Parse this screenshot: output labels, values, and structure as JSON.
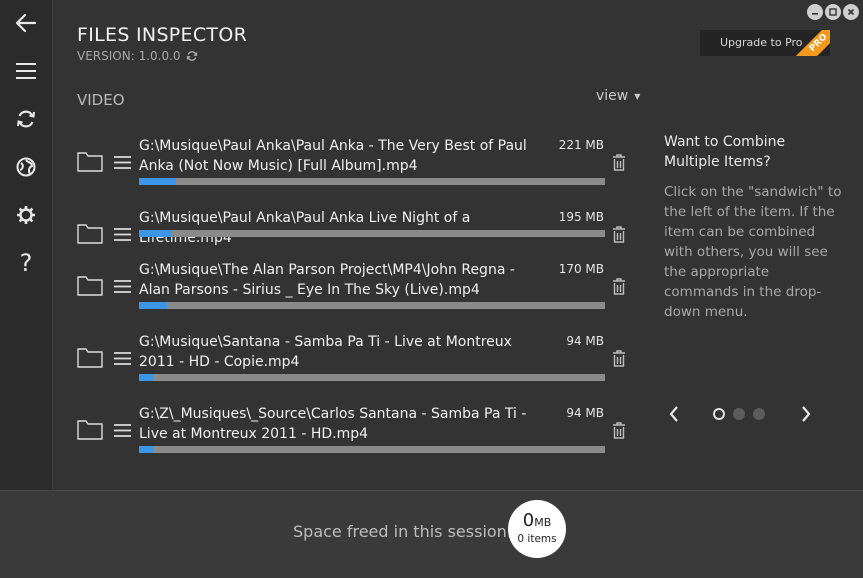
{
  "window": {
    "title": "FILES INSPECTOR",
    "version": "VERSION: 1.0.0.0"
  },
  "sidebar": {
    "items": [
      {
        "name": "back",
        "icon": "arrow-left-icon"
      },
      {
        "name": "menu",
        "icon": "hamburger-icon"
      },
      {
        "name": "refresh",
        "icon": "refresh-icon"
      },
      {
        "name": "globe",
        "icon": "globe-icon"
      },
      {
        "name": "settings",
        "icon": "gear-icon"
      },
      {
        "name": "help",
        "icon": "question-icon",
        "glyph": "?"
      }
    ]
  },
  "upgrade": {
    "label": "Upgrade to Pro",
    "badge": "PRO",
    "badge_color": "#f39a1d"
  },
  "main": {
    "section_title": "VIDEO",
    "view_label": "view",
    "view_caret": "▼"
  },
  "files": [
    {
      "name": "G:\\Musique\\Paul Anka\\Paul Anka - The Very Best of Paul Anka (Not Now Music) [Full Album].mp4",
      "size": "221 MB",
      "progress": 0.08
    },
    {
      "name": "G:\\Musique\\Paul Anka\\Paul Anka Live Night of a Lifetime.mp4",
      "size": "195 MB",
      "progress": 0.07
    },
    {
      "name": "G:\\Musique\\The Alan Parson Project\\MP4\\John Regna - Alan Parsons - Sirius _ Eye In The Sky (Live).mp4",
      "size": "170 MB",
      "progress": 0.06
    },
    {
      "name": "G:\\Musique\\Santana - Samba Pa Ti - Live at Montreux 2011 - HD - Copie.mp4",
      "size": "94 MB",
      "progress": 0.03
    },
    {
      "name": "G:\\Z\\_Musiques\\_Source\\Carlos Santana - Samba Pa Ti - Live at Montreux 2011 - HD.mp4",
      "size": "94 MB",
      "progress": 0.03
    }
  ],
  "tip": {
    "title": "Want to Combine Multiple Items?",
    "body": "Click on the \"sandwich\" to the left of the item. If the item can be combined with others, you will see the appropriate commands in the drop-down menu."
  },
  "carousel": {
    "current": 1,
    "total": 3
  },
  "footer": {
    "label": "Space freed in this session:",
    "freed_size": "0",
    "freed_unit": "MB",
    "freed_items": "0 items"
  },
  "colors": {
    "background": "#333333",
    "progress": "#3d95e8",
    "track": "#8a8a8a",
    "accent": "#f39a1d"
  }
}
